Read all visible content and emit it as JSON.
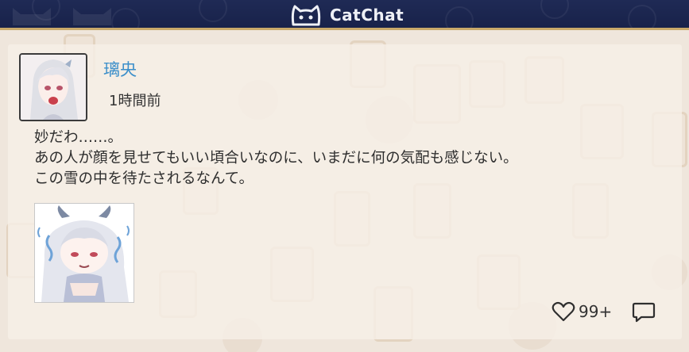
{
  "header": {
    "app_name": "CatChat",
    "logo_icon": "cat-face-icon"
  },
  "post": {
    "username": "璃央",
    "timestamp": "1時間前",
    "message_lines": [
      "妙だわ……。",
      "あの人が顔を見せてもいい頃合いなのに、いまだに何の気配も感じない。",
      "この雪の中を待たされるなんて。"
    ],
    "avatar_icon": "user-avatar",
    "sticker_icon": "chibi-sticker-image",
    "likes": "99+",
    "like_icon": "heart-icon",
    "comment_icon": "comment-icon"
  },
  "colors": {
    "header_bg": "#1f2a55",
    "header_border": "#c9a96a",
    "username": "#3c8fca",
    "background": "#efe6dc"
  }
}
